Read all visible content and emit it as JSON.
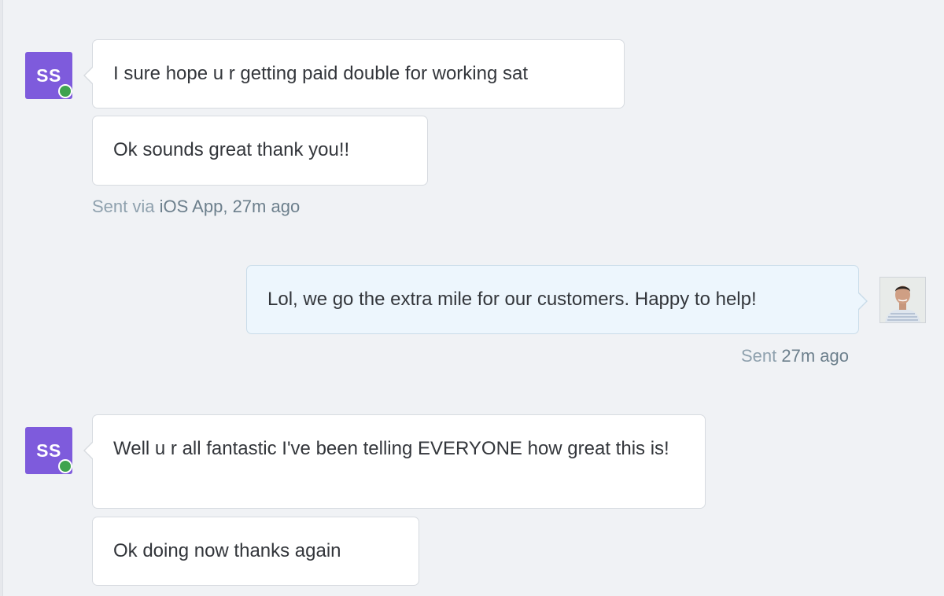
{
  "conversation": {
    "messages": [
      {
        "text": "I sure hope u r getting paid double for working sat",
        "author_initials": "SS"
      },
      {
        "text": "Ok sounds great thank you!!"
      },
      {
        "text": "Lol, we go the extra mile for our customers. Happy to help!"
      },
      {
        "text": "Well u r all fantastic I've been telling EVERYONE how great this is!",
        "author_initials": "SS"
      },
      {
        "text": "Ok doing now thanks again"
      }
    ],
    "customer_meta": {
      "prefix": "Sent via ",
      "source": "iOS App",
      "separator": ", ",
      "time": "27m ago"
    },
    "agent_meta": {
      "prefix": "Sent ",
      "time": "27m ago"
    }
  },
  "colors": {
    "background": "#f0f2f5",
    "customer_avatar": "#7e5bdc",
    "online_status": "#3ea34f",
    "agent_bubble": "#edf6fd",
    "customer_bubble": "#ffffff",
    "meta_text": "#8fa1ae"
  },
  "icons": {
    "online_indicator": "online-status-dot",
    "agent_avatar": "agent-photo"
  }
}
